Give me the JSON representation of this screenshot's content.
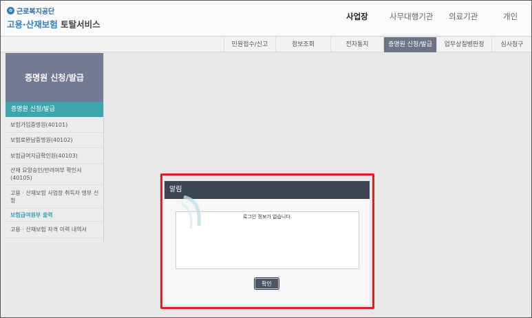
{
  "header": {
    "org_name": "근로복지공단",
    "service_name_part1": "고용·산재보험",
    "service_name_part2": " 토탈서비스",
    "nav": [
      {
        "label": "사업장",
        "active": true
      },
      {
        "label": "사무대행기관",
        "active": false
      },
      {
        "label": "의료기관",
        "active": false
      },
      {
        "label": "개인",
        "active": false
      }
    ]
  },
  "subnav": [
    {
      "label": "민원접수/신고",
      "active": false
    },
    {
      "label": "정보조회",
      "active": false
    },
    {
      "label": "전자통지",
      "active": false
    },
    {
      "label": "증명원 신청/발급",
      "active": true
    },
    {
      "label": "업무상질병판정",
      "active": false
    },
    {
      "label": "심사청구",
      "active": false
    }
  ],
  "sidebar": {
    "title": "증명원 신청/발급",
    "active_item": "증명원 신청/발급",
    "items": [
      {
        "label": "보험가입증명원(40101)",
        "highlight": false
      },
      {
        "label": "보험료완납증명원(40102)",
        "highlight": false
      },
      {
        "label": "보험급여지급확인원(40103)",
        "highlight": false
      },
      {
        "label": "산재 요양승인/반려여부 확인서 (40105)",
        "highlight": false
      },
      {
        "label": "고용 · 산재보험 사업장 취득자 명부 신청",
        "highlight": false
      },
      {
        "label": "보험급여원부 출력",
        "highlight": true
      },
      {
        "label": "고용 · 산재보험 자격 이력 내역서",
        "highlight": false
      }
    ]
  },
  "modal": {
    "title": "알림",
    "message": "로그인 정보가 없습니다.",
    "ok_label": "확인"
  },
  "colors": {
    "sidebar_header": "#737a94",
    "sidebar_active": "#3ca5ae",
    "subnav_active": "#6b7586",
    "modal_title": "#3b4552",
    "highlight_border": "#e21d24"
  }
}
